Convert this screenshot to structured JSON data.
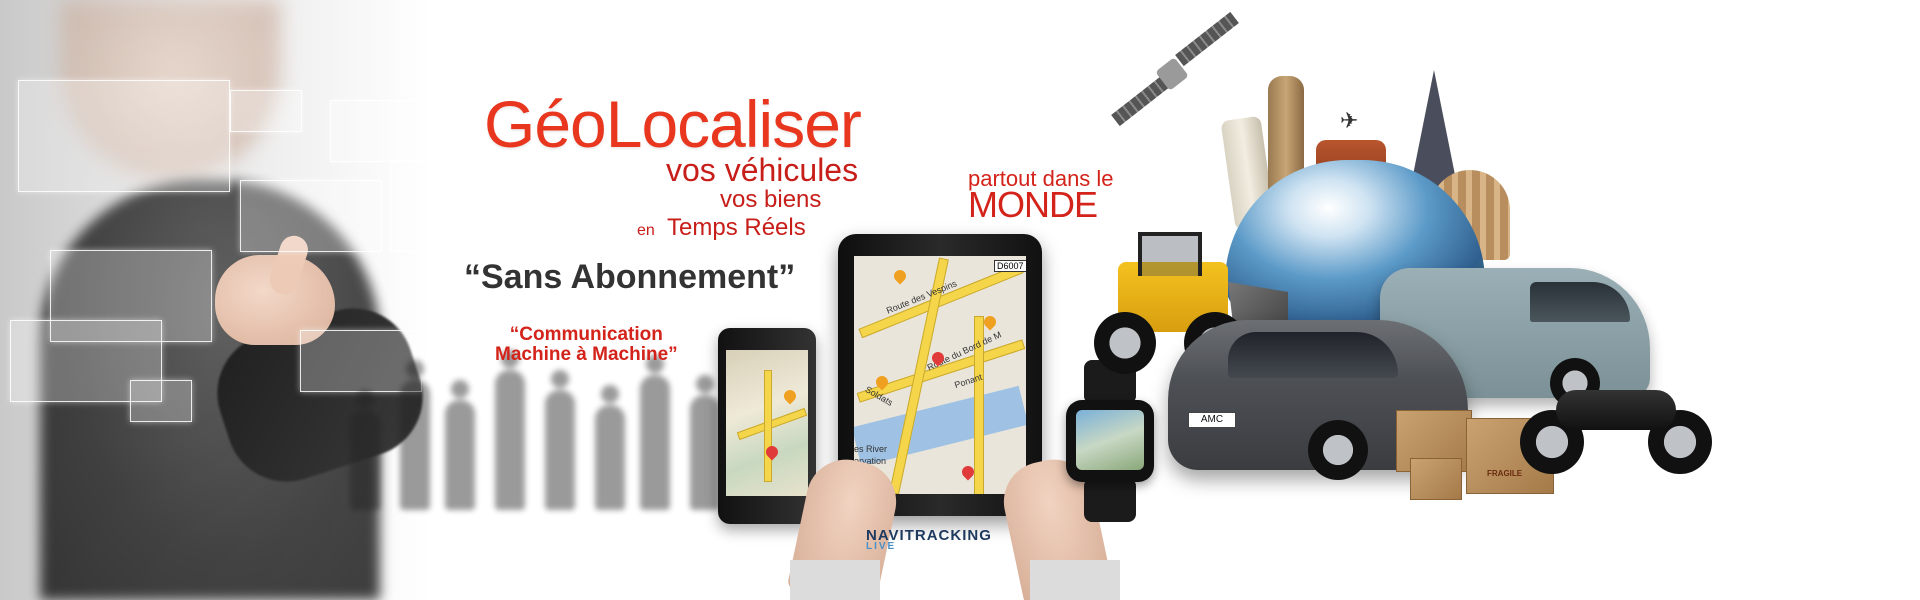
{
  "banner": {
    "title": "GéoLocaliser",
    "line1": "vos véhicules",
    "line2": "vos biens",
    "line3_prefix": "en",
    "line3": "Temps Réels",
    "slogan": "“Sans Abonnement”",
    "m2m_line1": "“Communication",
    "m2m_line2": "Machine à Machine”",
    "world_line1": "partout dans le",
    "world_line2": "MONDE",
    "logo_main": "NAVITRACKING",
    "logo_sub": "LIVE",
    "car_plate": "AMC",
    "map_badge": "D6007",
    "map_labels": [
      "Route des Vespins",
      "Route du Bord de M",
      "Ponant",
      "Soldats",
      "es River",
      "ervation"
    ],
    "box_label": "FRAGILE"
  },
  "colors": {
    "title": "#e8361f",
    "subtitle": "#c81e1a",
    "slogan": "#333333"
  },
  "icons": [
    "satellite-icon",
    "globe-icon",
    "map-pin-icon",
    "airplane-icon"
  ]
}
